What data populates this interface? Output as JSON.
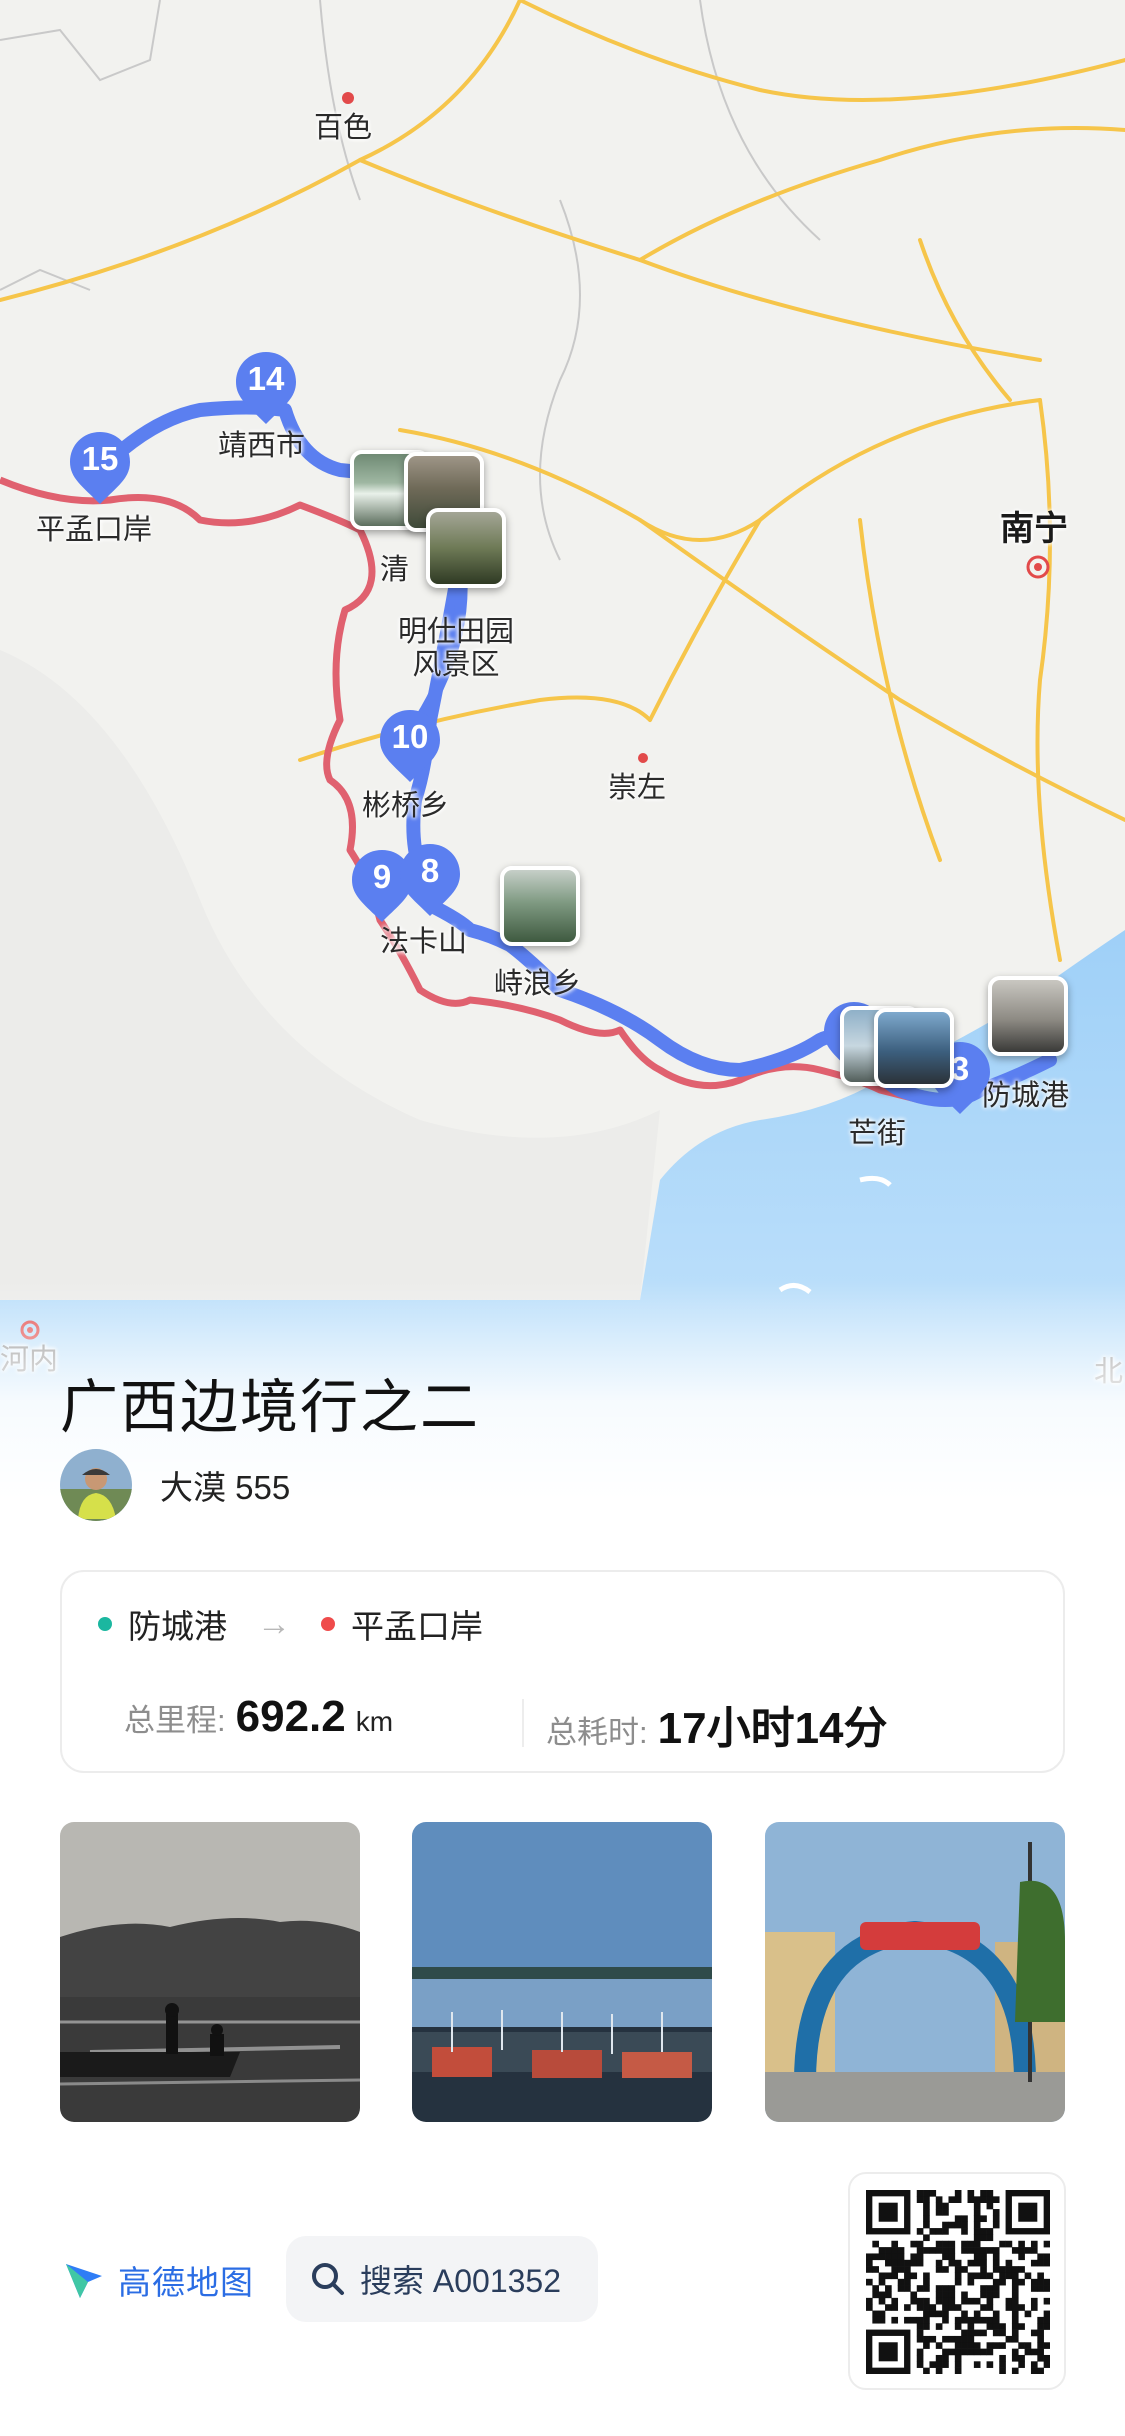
{
  "map": {
    "places": {
      "baise": "百色",
      "jingxi": "靖西市",
      "pingmeng": "平孟口岸",
      "qingshan": "清",
      "mingshi": "明仕田园\n风景区",
      "shanqiao": "彬桥乡",
      "chongzuo": "崇左",
      "faka": "法卡山",
      "shilang": "峙浪乡",
      "nanning": "南宁",
      "mangjie": "芒街",
      "fangcheng": "防城港",
      "hanoi": "河内",
      "north_edge": "北"
    },
    "pins": [
      "15",
      "14",
      "10",
      "9",
      "8",
      "3"
    ],
    "colors": {
      "route": "#5b7ff0",
      "border": "#e0616f",
      "road": "#f6c54a",
      "water": "#a8d3f7"
    }
  },
  "trip": {
    "title": "广西边境行之二",
    "author": "大漠 555",
    "start": "防城港",
    "arrow": "→",
    "end": "平孟口岸",
    "distance_label": "总里程:",
    "distance_value": "692.2",
    "distance_unit": "km",
    "time_label": "总耗时:",
    "time_value": "17小时14分",
    "start_color": "#1bb7a0",
    "end_color": "#ef4b4b"
  },
  "footer": {
    "brand": "高德地图",
    "search_text": "搜索 A001352",
    "brand_color": "#2b6de4"
  }
}
